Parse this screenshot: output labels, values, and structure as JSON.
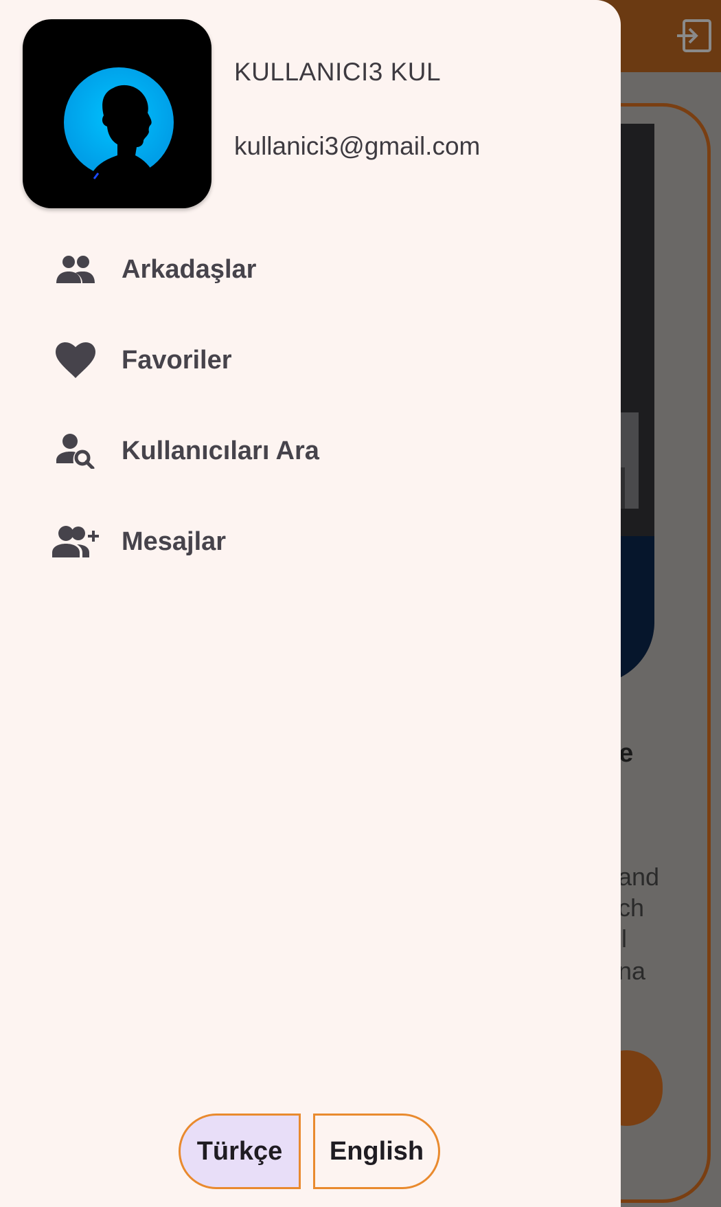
{
  "background": {
    "visible_text": [
      "ce",
      "and",
      "ch",
      "l",
      "na"
    ]
  },
  "drawer": {
    "user": {
      "name": "KULLANICI3 KUL",
      "email": "kullanici3@gmail.com"
    },
    "menu": [
      {
        "label": "Arkadaşlar",
        "icon": "group-icon"
      },
      {
        "label": "Favoriler",
        "icon": "heart-icon"
      },
      {
        "label": "Kullanıcıları Ara",
        "icon": "person-search-icon"
      },
      {
        "label": "Mesajlar",
        "icon": "group-add-icon"
      }
    ],
    "languages": {
      "turkish": "Türkçe",
      "english": "English",
      "selected": "turkish"
    }
  },
  "colors": {
    "drawer_bg": "#fdf4f1",
    "accent_orange": "#e98a2e",
    "selected_lang_bg": "#e8def8",
    "appbar_brown": "#6b3a12",
    "avatar_ring_blue": "#00b4ff"
  }
}
